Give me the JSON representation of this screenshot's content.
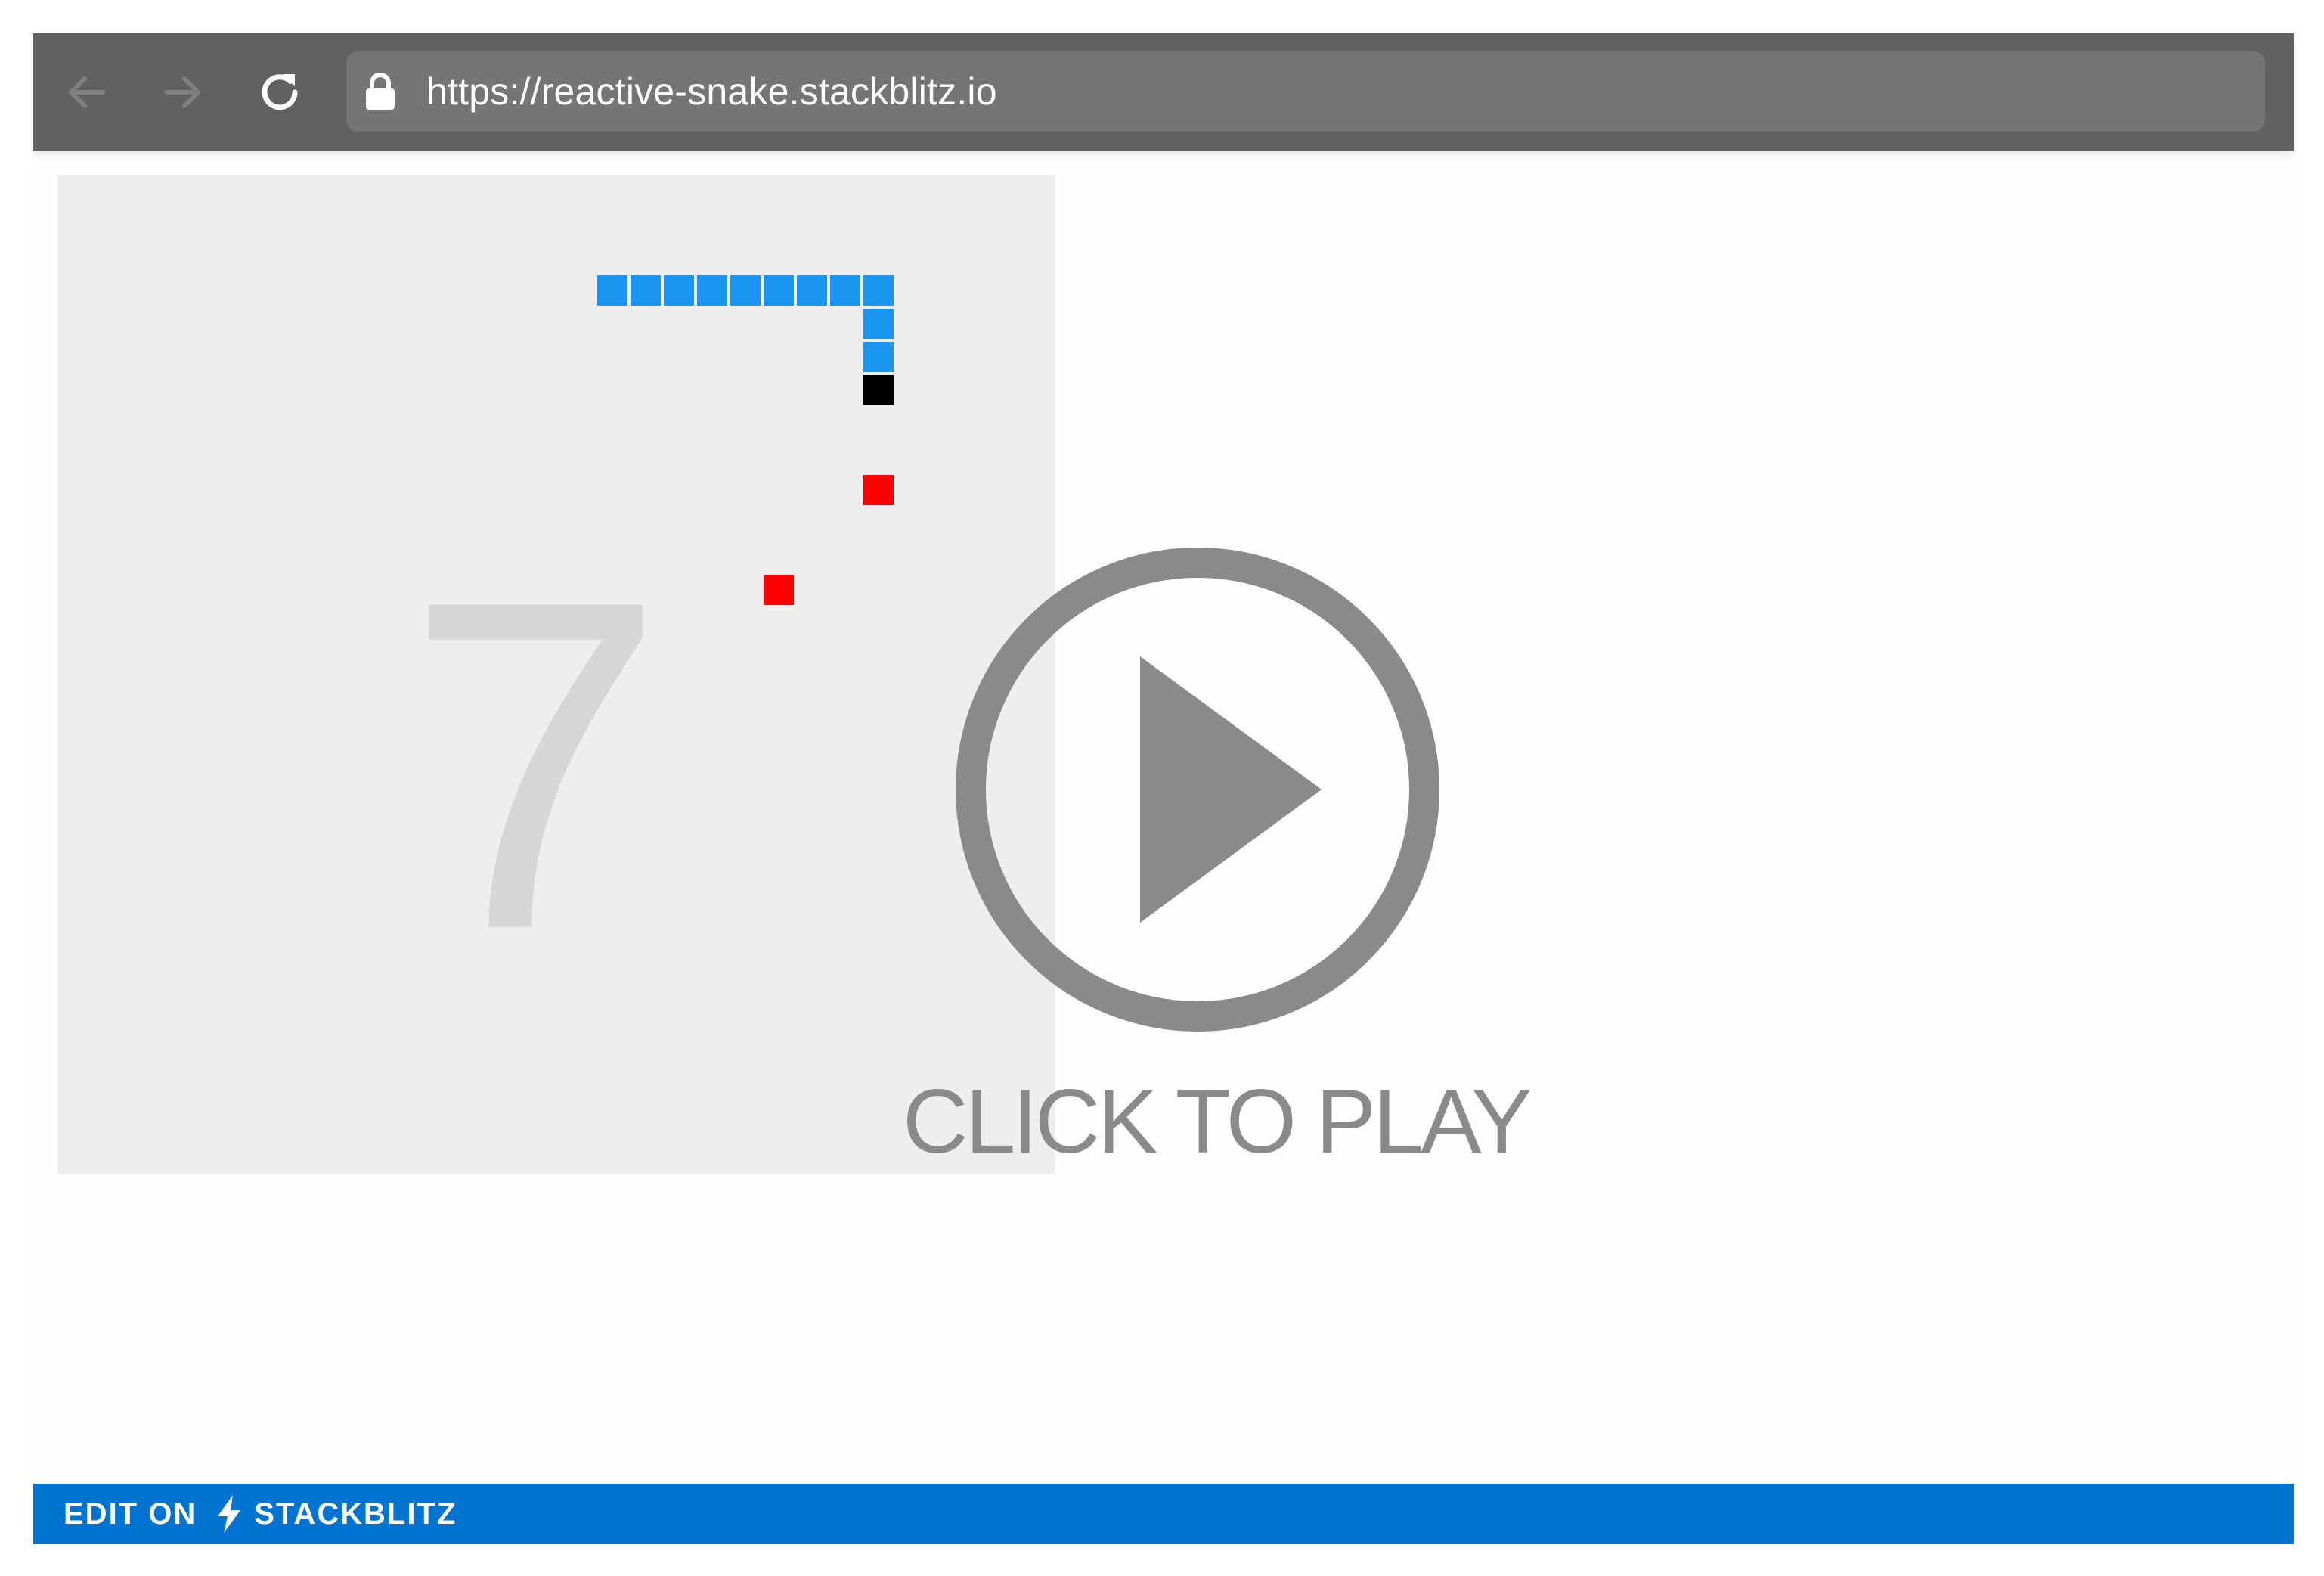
{
  "browser": {
    "url": "https://reactive-snake.stackblitz.io",
    "back_icon": "arrow-left-icon",
    "forward_icon": "arrow-right-icon",
    "reload_icon": "reload-icon",
    "lock_icon": "lock-icon"
  },
  "game": {
    "score": "7",
    "colors": {
      "background": "#eeeeee",
      "snake_body": "#1a96f0",
      "snake_head": "#000000",
      "food": "#ff0000",
      "score": "#d6d6d6"
    }
  },
  "overlay": {
    "label": "CLICK TO PLAY",
    "icon": "play-icon",
    "color": "#8a8a8a"
  },
  "footer": {
    "edit_label": "EDIT ON",
    "brand_label": "STACKBLITZ",
    "icon": "lightning-bolt-icon",
    "color": "#0074d0"
  }
}
